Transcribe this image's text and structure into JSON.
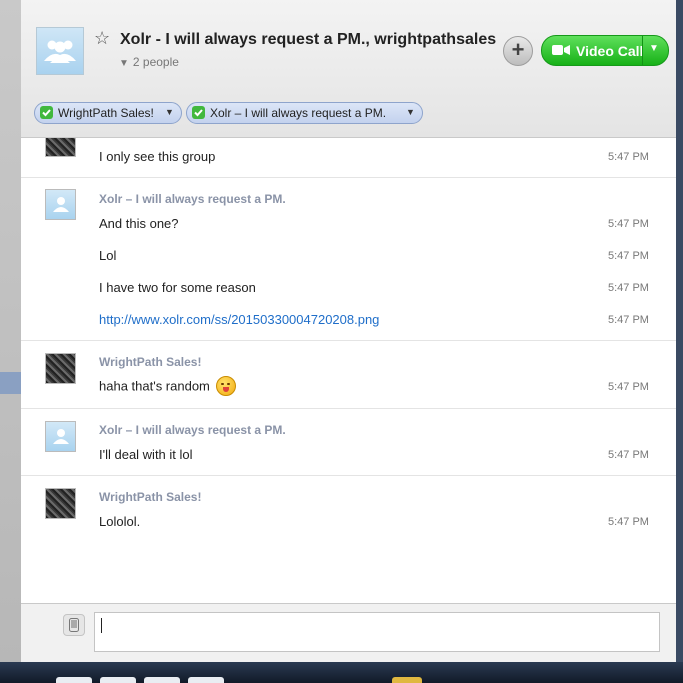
{
  "conversation": {
    "title": "Xolr - I will always request a PM., wrightpathsales",
    "people_count": "2 people",
    "add_label": "+",
    "video_call_label": "Video Call"
  },
  "participants": [
    {
      "name": "WrightPath Sales!",
      "status": "online"
    },
    {
      "name": "Xolr – I will always request a PM.",
      "status": "online"
    }
  ],
  "messages": [
    {
      "sender": "",
      "avatar": "gray",
      "lines": [
        {
          "text": "I only see this group",
          "time": "5:47 PM"
        }
      ]
    },
    {
      "sender": "Xolr – I will always request a PM.",
      "avatar": "blue",
      "lines": [
        {
          "text": "And this one?",
          "time": "5:47 PM"
        },
        {
          "text": "Lol",
          "time": "5:47 PM"
        },
        {
          "text": "I have two for some reason",
          "time": "5:47 PM"
        },
        {
          "text": "http://www.xolr.com/ss/20150330004720208.png",
          "time": "5:47 PM",
          "link": true
        }
      ]
    },
    {
      "sender": "WrightPath Sales!",
      "avatar": "gray",
      "lines": [
        {
          "text": "haha that's random",
          "time": "5:47 PM",
          "emoji": "tongue-out-emoji"
        }
      ]
    },
    {
      "sender": "Xolr – I will always request a PM.",
      "avatar": "blue",
      "lines": [
        {
          "text": "I'll deal with it lol",
          "time": "5:47 PM"
        }
      ]
    },
    {
      "sender": "WrightPath Sales!",
      "avatar": "gray",
      "lines": [
        {
          "text": "Lololol.",
          "time": "5:47 PM"
        }
      ]
    }
  ],
  "composer": {
    "value": ""
  },
  "colors": {
    "accent_green": "#17b117",
    "link": "#1f6ec9",
    "sender": "#8a93a7",
    "chip_bg": "#c3d2ee"
  }
}
